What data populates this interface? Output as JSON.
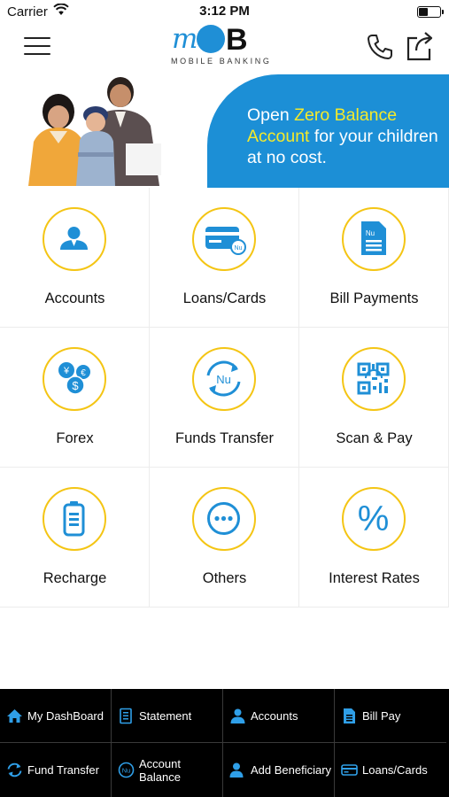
{
  "status_bar": {
    "carrier": "Carrier",
    "time": "3:12 PM"
  },
  "header": {
    "logo_m": "m",
    "logo_ob": "B",
    "logo_subtitle": "MOBILE BANKING"
  },
  "banner": {
    "line_start": "Open ",
    "highlight": "Zero Balance Account",
    "line_end": " for your children at no cost."
  },
  "grid": [
    {
      "label": "Accounts",
      "icon": "account-person-icon"
    },
    {
      "label": "Loans/Cards",
      "icon": "card-icon"
    },
    {
      "label": "Bill Payments",
      "icon": "bill-icon"
    },
    {
      "label": "Forex",
      "icon": "currency-coins-icon"
    },
    {
      "label": "Funds Transfer",
      "icon": "transfer-cycle-icon"
    },
    {
      "label": "Scan & Pay",
      "icon": "qr-code-icon"
    },
    {
      "label": "Recharge",
      "icon": "battery-icon"
    },
    {
      "label": "Others",
      "icon": "more-dots-icon"
    },
    {
      "label": "Interest Rates",
      "icon": "percent-icon"
    }
  ],
  "bottom_tabs": [
    {
      "label": "My DashBoard",
      "icon": "home-icon"
    },
    {
      "label": "Statement",
      "icon": "statement-icon"
    },
    {
      "label": "Accounts",
      "icon": "person-icon"
    },
    {
      "label": "Bill Pay",
      "icon": "bill-icon"
    },
    {
      "label": "Fund Transfer",
      "icon": "refresh-icon"
    },
    {
      "label": "Account Balance",
      "icon": "nu-coin-icon"
    },
    {
      "label": "Add Beneficiary",
      "icon": "add-person-icon"
    },
    {
      "label": "Loans/Cards",
      "icon": "card-icon"
    }
  ],
  "colors": {
    "brand_blue": "#1f8fd6",
    "accent_yellow": "#f4c514",
    "banner_highlight": "#f5ea2a",
    "bottom_bar": "#000000"
  }
}
